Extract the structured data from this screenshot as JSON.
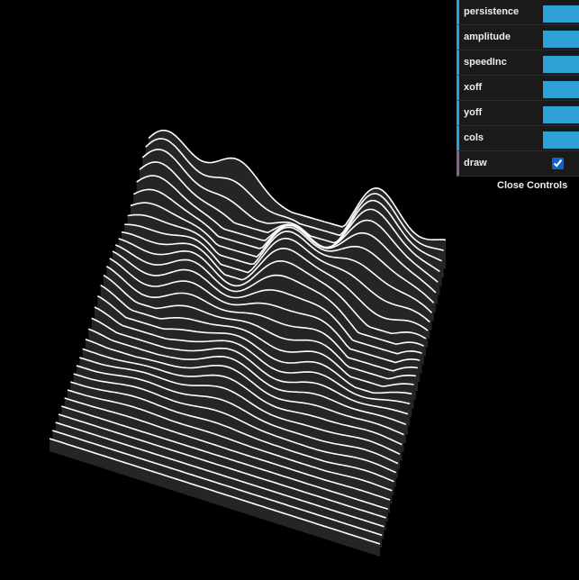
{
  "controls": [
    {
      "id": "persistence",
      "label": "persistence",
      "type": "number",
      "color": "#2fa1d6"
    },
    {
      "id": "amplitude",
      "label": "amplitude",
      "type": "number",
      "color": "#2fa1d6"
    },
    {
      "id": "speedinc",
      "label": "speedInc",
      "type": "number",
      "color": "#2fa1d6"
    },
    {
      "id": "xoff",
      "label": "xoff",
      "type": "number",
      "color": "#2fa1d6"
    },
    {
      "id": "yoff",
      "label": "yoff",
      "type": "number",
      "color": "#2fa1d6"
    },
    {
      "id": "cols",
      "label": "cols",
      "type": "number",
      "color": "#2fa1d6"
    },
    {
      "id": "draw",
      "label": "draw",
      "type": "boolean",
      "checked": true
    }
  ],
  "close_label": "Close Controls",
  "colors": {
    "background": "#000000",
    "line": "#ffffff",
    "surface_fill": "#252525",
    "slider": "#2fa1d6",
    "boolean_accent": "#806787"
  }
}
